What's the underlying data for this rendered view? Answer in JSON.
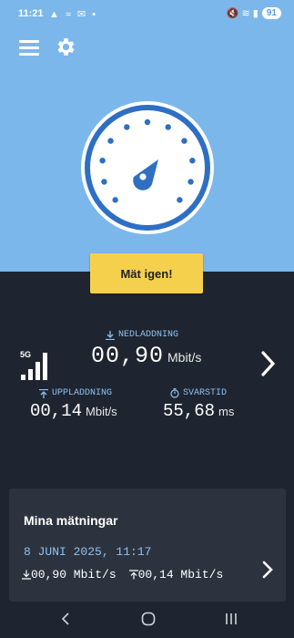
{
  "status": {
    "time": "11:21",
    "left_icons": "▲ ≈ ✉ •",
    "right_icons": "🔇 ≋ ▮",
    "battery": "91"
  },
  "header": {
    "menu_icon": "hamburger-icon",
    "settings_icon": "gear-icon"
  },
  "dial": {
    "icon": "speedometer-compass-icon",
    "colors": {
      "ring": "#2e6fc4",
      "face": "#ffffff"
    }
  },
  "retry_button": {
    "label": "Mät igen!"
  },
  "result": {
    "network": "5G",
    "download": {
      "label": "NEDLADDNING",
      "value": "00,90",
      "unit": "Mbit/s"
    },
    "upload": {
      "label": "UPPLADDNING",
      "value": "00,14",
      "unit": "Mbit/s"
    },
    "ping": {
      "label": "SVARSTID",
      "value": "55,68",
      "unit": "ms"
    }
  },
  "history": {
    "title": "Mina mätningar",
    "date": "8 JUNI 2025, 11:17",
    "download": "00,90 Mbit/s",
    "upload": "00,14 Mbit/s"
  },
  "colors": {
    "sky": "#7cb7eb",
    "panel": "#1f2530",
    "card": "#2c333f",
    "accent": "#f5d04d",
    "label_blue": "#8fc0f0"
  }
}
